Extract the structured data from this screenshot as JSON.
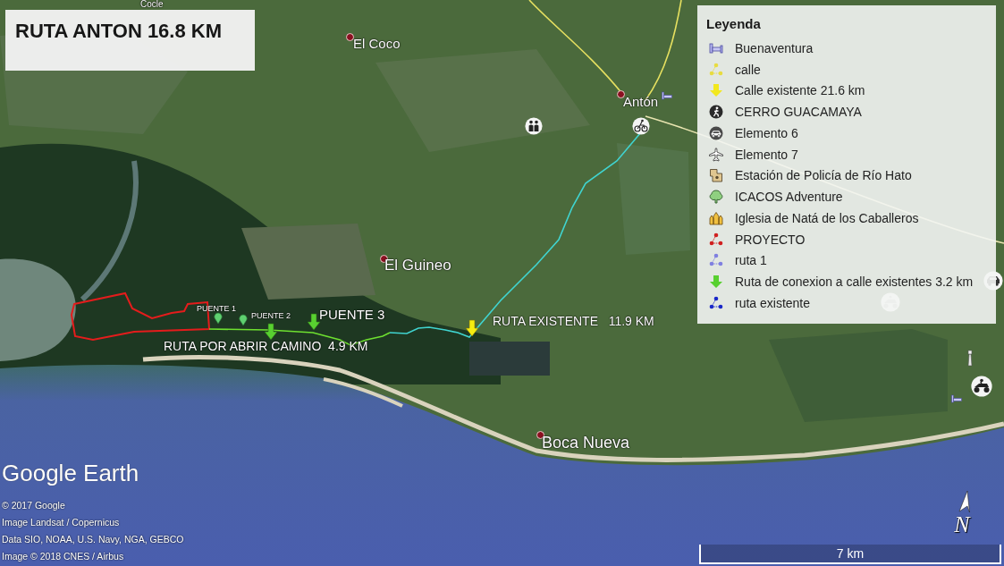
{
  "title_box": {
    "title": "RUTA ANTON 16.8 KM"
  },
  "places": [
    {
      "name": "Cocle",
      "marker": false
    },
    {
      "name": "El Coco",
      "marker": true
    },
    {
      "name": "Antón",
      "marker": true
    },
    {
      "name": "El Guineo",
      "marker": true
    },
    {
      "name": "Boca Nueva",
      "marker": true
    }
  ],
  "route_labels": [
    "PUENTE 1",
    "PUENTE 2",
    "PUENTE 3",
    "RUTA POR ABRIR CAMINO  4.9 KM",
    "RUTA EXISTENTE   11.9 KM"
  ],
  "legend": {
    "title": "Leyenda",
    "items": [
      {
        "label": "Buenaventura",
        "kind": "bed"
      },
      {
        "label": "calle",
        "kind": "path",
        "color": "#e8dc40"
      },
      {
        "label": "Calle existente 21.6 km",
        "kind": "arrow",
        "color": "#f2e81e"
      },
      {
        "label": "CERRO GUACAMAYA",
        "kind": "hiker"
      },
      {
        "label": "Elemento 6",
        "kind": "car"
      },
      {
        "label": "Elemento 7",
        "kind": "plane"
      },
      {
        "label": "Estación de Policía de Río Hato",
        "kind": "police"
      },
      {
        "label": "ICACOS Adventure",
        "kind": "tree"
      },
      {
        "label": "Iglesia de Natá de los Caballeros",
        "kind": "church"
      },
      {
        "label": "PROYECTO",
        "kind": "path",
        "color": "#d02020"
      },
      {
        "label": "ruta 1",
        "kind": "path",
        "color": "#8080e0"
      },
      {
        "label": "Ruta de conexion a calle existentes 3.2 km",
        "kind": "arrow",
        "color": "#58d030"
      },
      {
        "label": "ruta existente",
        "kind": "path",
        "color": "#1a28c8"
      }
    ]
  },
  "attribution": {
    "logo": "Google Earth",
    "lines": [
      "© 2017 Google",
      "Image Landsat / Copernicus",
      "Data SIO, NOAA, U.S. Navy, NGA, GEBCO",
      "Image © 2018 CNES / Airbus"
    ]
  },
  "scale_bar": {
    "label": "7 km"
  },
  "north_arrow": {
    "label": "N"
  }
}
